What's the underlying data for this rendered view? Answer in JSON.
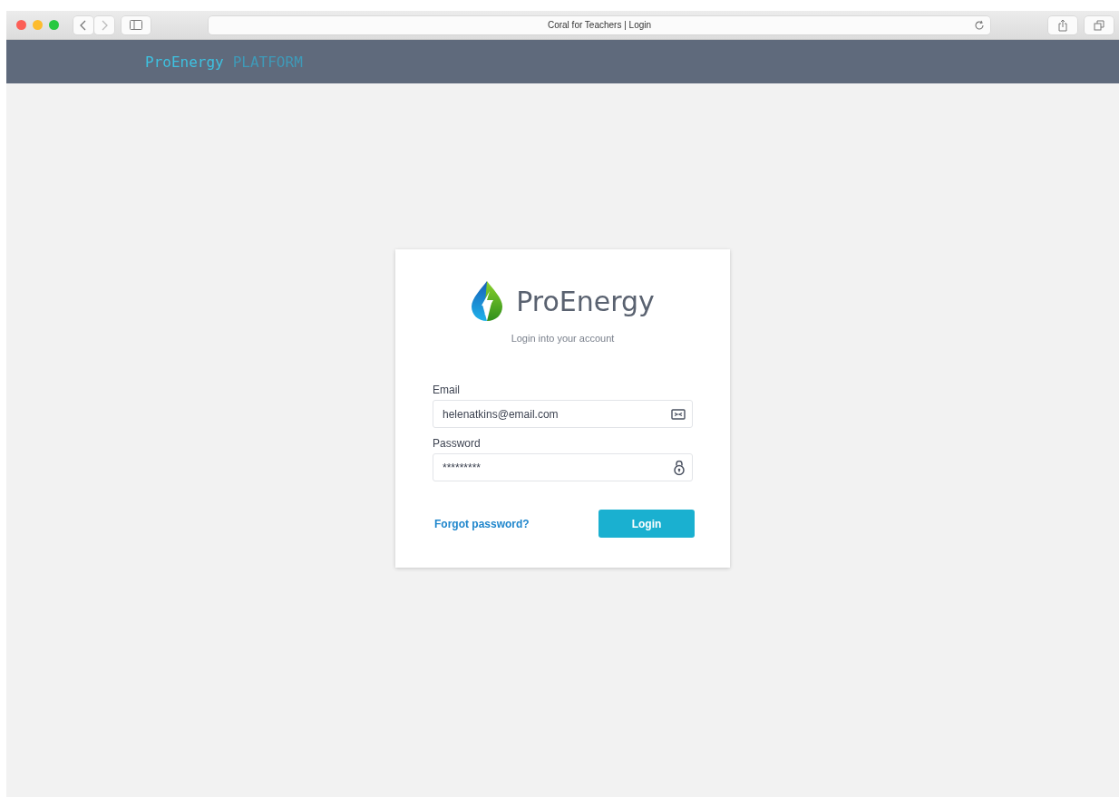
{
  "browser": {
    "tab_title": "Coral for Teachers | Login"
  },
  "header": {
    "brand": "ProEnergy",
    "suffix": "PLATFORM"
  },
  "login_card": {
    "logo_text": "ProEnergy",
    "subtitle": "Login into your account",
    "fields": [
      {
        "kind": "email",
        "label": "Email",
        "value": "helenatkins@email.com"
      },
      {
        "kind": "password",
        "label": "Password",
        "value": "*********"
      }
    ],
    "forgot_link": "Forgot password?",
    "submit": "Login"
  }
}
